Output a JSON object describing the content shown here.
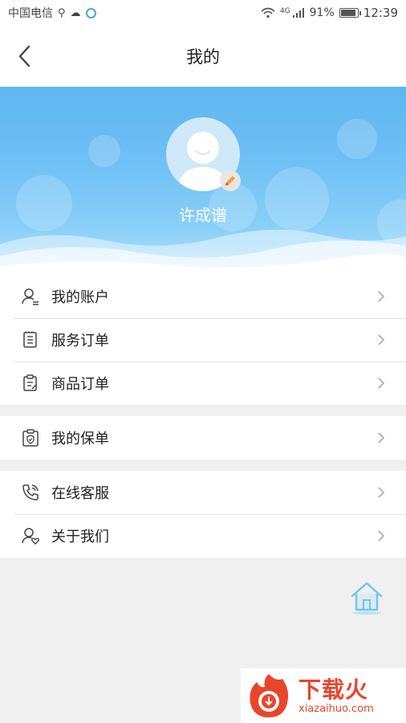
{
  "status_bar": {
    "carrier": "中国电信",
    "network": "4G",
    "battery": "91%",
    "time": "12:39"
  },
  "nav": {
    "title": "我的"
  },
  "profile": {
    "username": "许成谱"
  },
  "menu": {
    "group1": [
      {
        "label": "我的账户",
        "icon": "user-icon"
      },
      {
        "label": "服务订单",
        "icon": "document-list-icon"
      },
      {
        "label": "商品订单",
        "icon": "clipboard-icon"
      }
    ],
    "group2": [
      {
        "label": "我的保单",
        "icon": "shield-clipboard-icon"
      }
    ],
    "group3": [
      {
        "label": "在线客服",
        "icon": "phone-icon"
      },
      {
        "label": "关于我们",
        "icon": "user-heart-icon"
      }
    ]
  },
  "watermark": {
    "cn": "下载火",
    "en": "xiazaihuo.com"
  },
  "colors": {
    "header_gradient_top": "#5fb6f0",
    "header_gradient_bottom": "#b8e3fb",
    "watermark_red": "#e8462c",
    "home_icon_blue": "#6cc6ee"
  }
}
